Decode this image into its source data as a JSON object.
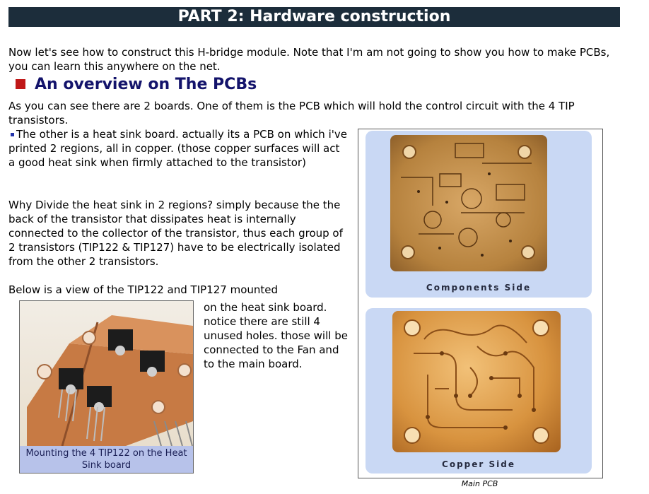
{
  "header": {
    "title": "PART 2: Hardware construction"
  },
  "intro": "Now let's see how to construct this H-bridge module. Note that I'm am not going to show you how to make PCBs, you can learn this anywhere on the net.",
  "section": {
    "title": "An overview on The PCBs"
  },
  "paragraphs": {
    "p1": "As you can see there are 2 boards. One of them is the PCB which will hold the control circuit with the 4 TIP transistors.",
    "p2": "The other is a heat sink board. actually its a PCB on which i've printed 2 regions, all in copper. (those copper surfaces will act a good heat sink when firmly attached to the transistor)",
    "p3": "Why Divide the heat sink in 2 regions? simply because the the back of the transistor that dissipates heat is internally connected to the collector of the transistor, thus each group of 2 transistors (TIP122 & TIP127) have to be electrically isolated from the other 2 transistors.",
    "p4": "Below is a view of the TIP122 and TIP127 mounted",
    "p5": "on the heat sink board. notice there are still 4 unused holes. those will be connected to the Fan and to the main board."
  },
  "figures": {
    "heatsink_caption": "Mounting the 4 TIP122 on the Heat Sink board",
    "components_label": "Components Side",
    "copper_label": "Copper Side",
    "main_caption": "Main PCB"
  },
  "colors": {
    "header_bg": "#1c2d3b",
    "heading": "#13136b",
    "bullet": "#c01818"
  }
}
